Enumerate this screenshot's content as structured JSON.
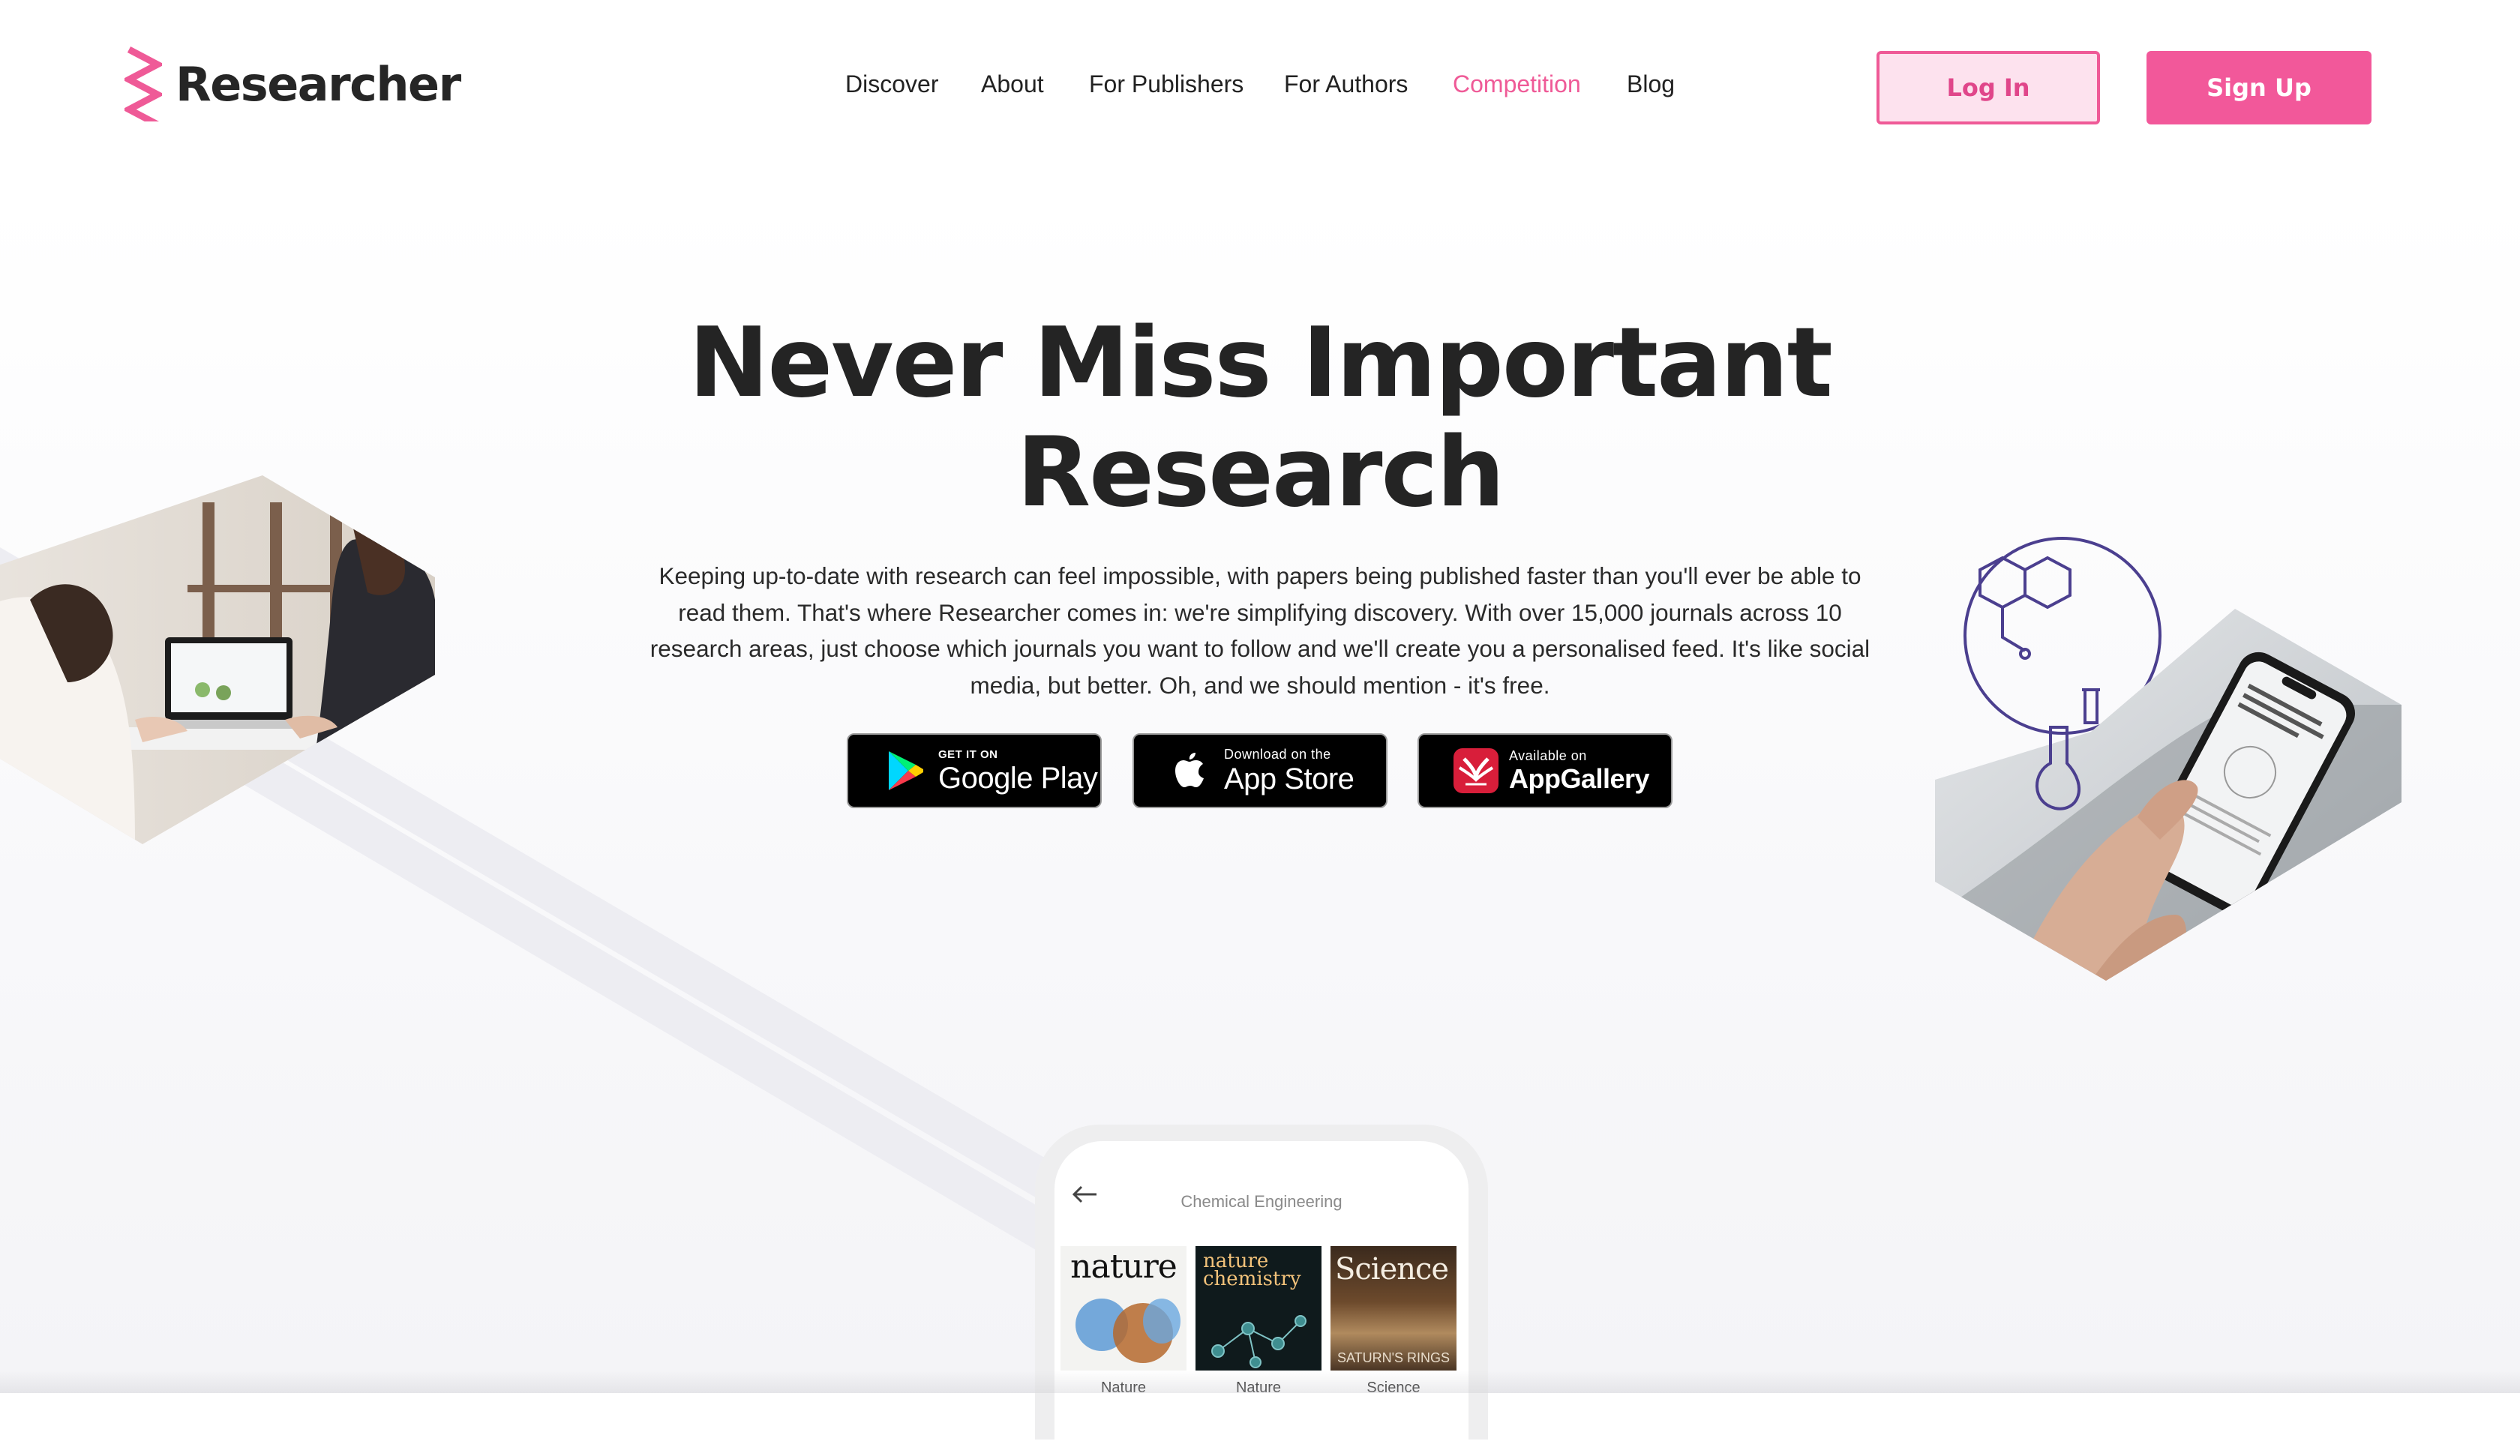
{
  "brand": {
    "name": "Researcher",
    "accent": "#ef5a97"
  },
  "nav": {
    "items": [
      {
        "label": "Discover"
      },
      {
        "label": "About"
      },
      {
        "label": "For Publishers"
      },
      {
        "label": "For Authors"
      },
      {
        "label": "Competition",
        "active": true
      },
      {
        "label": "Blog"
      }
    ]
  },
  "auth": {
    "login_label": "Log In",
    "signup_label": "Sign Up"
  },
  "hero": {
    "title_line1": "Never Miss Important",
    "title_line2": "Research",
    "description": "Keeping up-to-date with research can feel impossible, with papers being published faster than you'll ever be able to read them. That's where Researcher comes in: we're simplifying discovery. With over 15,000 journals across 10 research areas, just choose which journals you want to follow and we'll create you a personalised feed. It's like social media, but better. Oh, and we should mention - it's free."
  },
  "stores": {
    "google": {
      "small": "GET IT ON",
      "big": "Google Play",
      "icon": "google-play-icon"
    },
    "apple": {
      "small": "Download on the",
      "big": "App Store",
      "icon": "apple-icon"
    },
    "huawei": {
      "small": "Available on",
      "big": "AppGallery",
      "icon": "huawei-icon"
    }
  },
  "phone": {
    "screen_title": "Chemical Engineering",
    "back_icon": "arrow-left-icon",
    "journals": [
      {
        "cover_title": "nature",
        "label": "Nature"
      },
      {
        "cover_title": "nature chemistry",
        "label": "Nature"
      },
      {
        "cover_title": "Science",
        "cover_subtitle": "SATURN'S RINGS",
        "label": "Science"
      }
    ]
  }
}
